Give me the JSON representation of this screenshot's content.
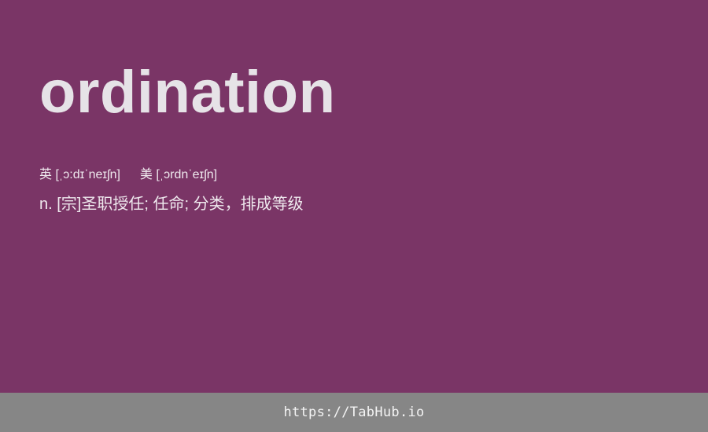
{
  "card": {
    "word": "ordination",
    "phonetic_uk_label": "英",
    "phonetic_uk": "[ˌɔ:dɪˈneɪʃn]",
    "phonetic_us_label": "美",
    "phonetic_us": "[ˌɔrdnˈeɪʃn]",
    "definition": "n. [宗]圣职授任; 任命; 分类，排成等级"
  },
  "footer": {
    "link_text": "https://TabHub.io"
  },
  "colors": {
    "background": "#7a3566",
    "footer_background": "#868686",
    "text": "#e6e3e7"
  }
}
